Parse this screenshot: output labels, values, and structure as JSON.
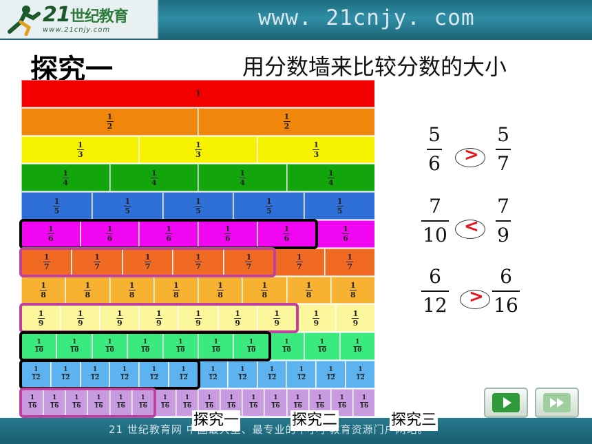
{
  "banner": {
    "logo_number": "21",
    "logo_text": "世纪教育",
    "logo_url": "www.21cnjy.com",
    "site_url": "www. 21cnjy. com"
  },
  "title": "探究一",
  "subtitle": "用分数墙来比较分数的大小",
  "fraction_wall": [
    {
      "label": "1",
      "count": 1,
      "color": "#f20000"
    },
    {
      "label": "1/2",
      "count": 2,
      "color": "#f0860c"
    },
    {
      "label": "1/3",
      "count": 3,
      "color": "#f7f200"
    },
    {
      "label": "1/4",
      "count": 4,
      "color": "#12a60c"
    },
    {
      "label": "1/5",
      "count": 5,
      "color": "#2e6fd8"
    },
    {
      "label": "1/6",
      "count": 6,
      "color": "#f006f0"
    },
    {
      "label": "1/7",
      "count": 7,
      "color": "#f06a24"
    },
    {
      "label": "1/8",
      "count": 8,
      "color": "#f7b232"
    },
    {
      "label": "1/9",
      "count": 9,
      "color": "#fcf79c"
    },
    {
      "label": "1/10",
      "count": 10,
      "color": "#3bea7e"
    },
    {
      "label": "1/12",
      "count": 12,
      "color": "#5cb3f0"
    },
    {
      "label": "1/16",
      "count": 16,
      "color": "#c89ae0"
    }
  ],
  "highlights": [
    {
      "row": 5,
      "cells": 5,
      "color": "#000000"
    },
    {
      "row": 6,
      "cells": 5,
      "color": "#c040a0"
    },
    {
      "row": 8,
      "cells": 7,
      "color": "#c040a0"
    },
    {
      "row": 9,
      "cells": 7,
      "color": "#000000"
    },
    {
      "row": 10,
      "cells": 6,
      "color": "#000000"
    },
    {
      "row": 11,
      "cells": 6,
      "color": "#c040a0"
    }
  ],
  "comparisons": [
    {
      "left_num": "5",
      "left_den": "6",
      "symbol": ">",
      "right_num": "5",
      "right_den": "7"
    },
    {
      "left_num": "7",
      "left_den": "10",
      "symbol": "<",
      "right_num": "7",
      "right_den": "9"
    },
    {
      "left_num": "6",
      "left_den": "12",
      "symbol": ">",
      "right_num": "6",
      "right_den": "16"
    }
  ],
  "nav": {
    "next": "play-icon",
    "forward": "fast-forward-icon"
  },
  "tabs": [
    "探究一",
    "探究二",
    "探究三"
  ],
  "footer": "21 世纪教育网     中国最大型、最专业的中小学教育资源门户网站。",
  "colors": {
    "symbol": "#e8121a",
    "banner": "#2f8ea6"
  }
}
